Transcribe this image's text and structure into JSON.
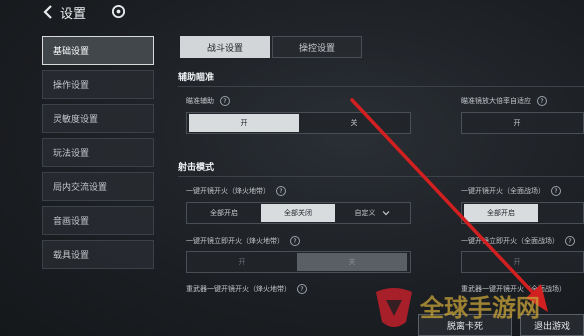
{
  "header": {
    "title": "设置",
    "back_icon": "back-arrow-icon",
    "logo_icon": "game-logo-icon"
  },
  "sidebar": {
    "items": [
      {
        "label": "基础设置",
        "active": true
      },
      {
        "label": "操作设置",
        "active": false
      },
      {
        "label": "灵敏度设置",
        "active": false
      },
      {
        "label": "玩法设置",
        "active": false
      },
      {
        "label": "局内交流设置",
        "active": false
      },
      {
        "label": "音画设置",
        "active": false
      },
      {
        "label": "载具设置",
        "active": false
      }
    ]
  },
  "tabs": [
    {
      "label": "战斗设置",
      "active": true
    },
    {
      "label": "操控设置",
      "active": false
    }
  ],
  "sections": {
    "aim": {
      "title": "辅助瞄准",
      "aim_assist": {
        "label": "瞄准辅助",
        "options": [
          "开",
          "关"
        ],
        "selected": "开"
      },
      "scope_adapt": {
        "label": "瞄准镜放大倍率自适应",
        "options": [
          "开"
        ],
        "selected": ""
      }
    },
    "shoot": {
      "title": "射击模式",
      "one_key_fire_beacon": {
        "label": "一键开镜开火（烽火地带）",
        "options": [
          "全部开启",
          "全部关闭",
          "自定义"
        ],
        "selected": "全部关闭"
      },
      "one_key_fire_battlefield": {
        "label": "一键开镜开火（全面战场）",
        "options": [
          "全部开启"
        ],
        "selected": "全部开启"
      },
      "instant_fire_beacon": {
        "label": "一键开镜立即开火（烽火地带）",
        "options": [
          "开",
          "关"
        ],
        "selected": "关"
      },
      "instant_fire_battlefield": {
        "label": "一键开镜立即开火（全面战场）",
        "options": [
          "开"
        ],
        "selected": ""
      },
      "heavy_weapon_beacon": {
        "label": "重武器一键开镜开火（烽火地带）"
      },
      "heavy_weapon_battlefield": {
        "label": "重武器一键开镜开火（全面战场）"
      }
    }
  },
  "bottom": {
    "card_label": "脱离卡死",
    "exit_label": "退出游戏"
  },
  "watermark": {
    "text": "全球手游网"
  },
  "colors": {
    "arrow": "#d21f1f",
    "selected_bg": "#d9dcdf",
    "active_sidebar_border": "#d8dadc"
  }
}
